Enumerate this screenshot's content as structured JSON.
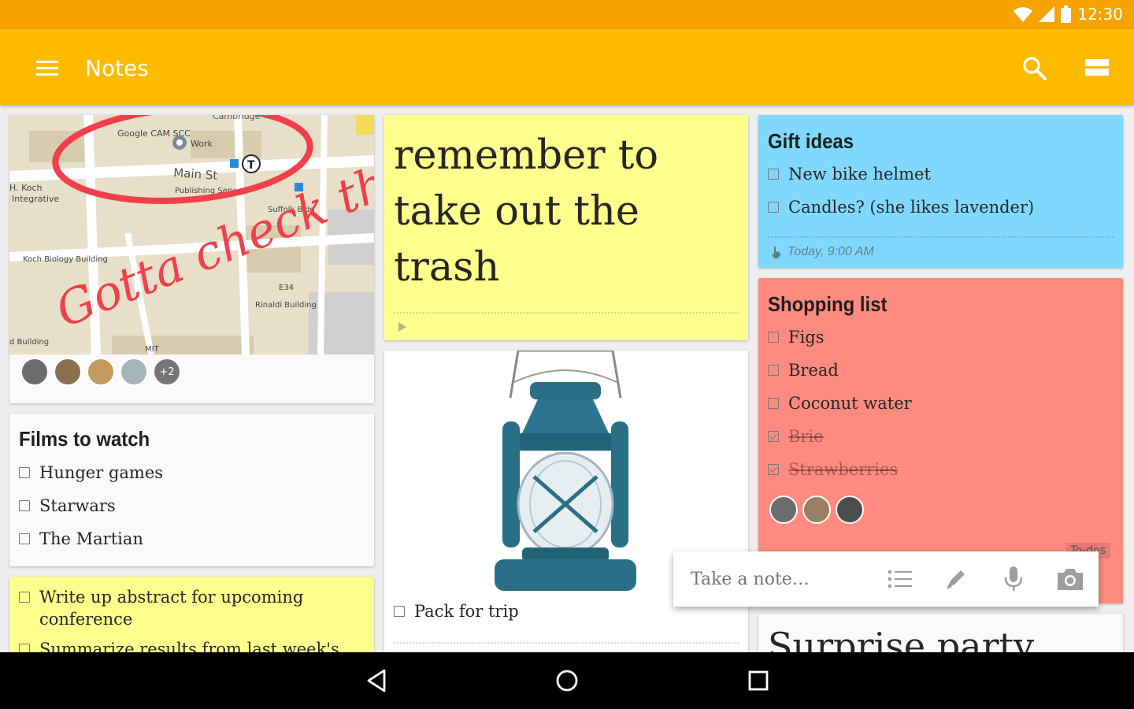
{
  "status": {
    "time": "12:30"
  },
  "appbar": {
    "title": "Notes"
  },
  "notes": {
    "map_note": {
      "map_labels": [
        "Google CAM SCC",
        "Work",
        "Main St",
        "H. Koch",
        "Integrative",
        "Publishing Serv",
        "Suffolk Bldg",
        "Koch Biology Building",
        "E34",
        "Rinaldi Building",
        "d Building",
        "MIT",
        "Cambridge"
      ],
      "handwriting": "Gotta check the atrium!",
      "collaborators_extra": "+2"
    },
    "films": {
      "title": "Films to watch",
      "items": [
        {
          "text": "Hunger games",
          "checked": false
        },
        {
          "text": "Starwars",
          "checked": false
        },
        {
          "text": "The Martian",
          "checked": false
        }
      ]
    },
    "abstract": {
      "item1": "Write up abstract for upcoming conference",
      "item2": "Summarize results from last week's"
    },
    "trash": {
      "text": "remember to take out the trash"
    },
    "lantern": {
      "item": "Pack for trip"
    },
    "gifts": {
      "title": "Gift ideas",
      "items": [
        {
          "text": "New bike helmet",
          "checked": false
        },
        {
          "text": "Candles? (she likes lavender)",
          "checked": false
        }
      ],
      "reminder": "Today, 9:00 AM"
    },
    "shopping": {
      "title": "Shopping list",
      "items": [
        {
          "text": "Figs",
          "checked": false
        },
        {
          "text": "Bread",
          "checked": false
        },
        {
          "text": "Coconut water",
          "checked": false
        },
        {
          "text": "Brie",
          "checked": true
        },
        {
          "text": "Strawberries",
          "checked": true
        }
      ],
      "label": "To-dos"
    },
    "party": {
      "title": "Surprise party"
    }
  },
  "take_note": {
    "placeholder": "Take a note…"
  },
  "colors": {
    "status": "#f5a300",
    "appbar": "#ffbb00",
    "yellow": "#ffff8d",
    "blue": "#80d8ff",
    "red": "#ff8a80"
  }
}
